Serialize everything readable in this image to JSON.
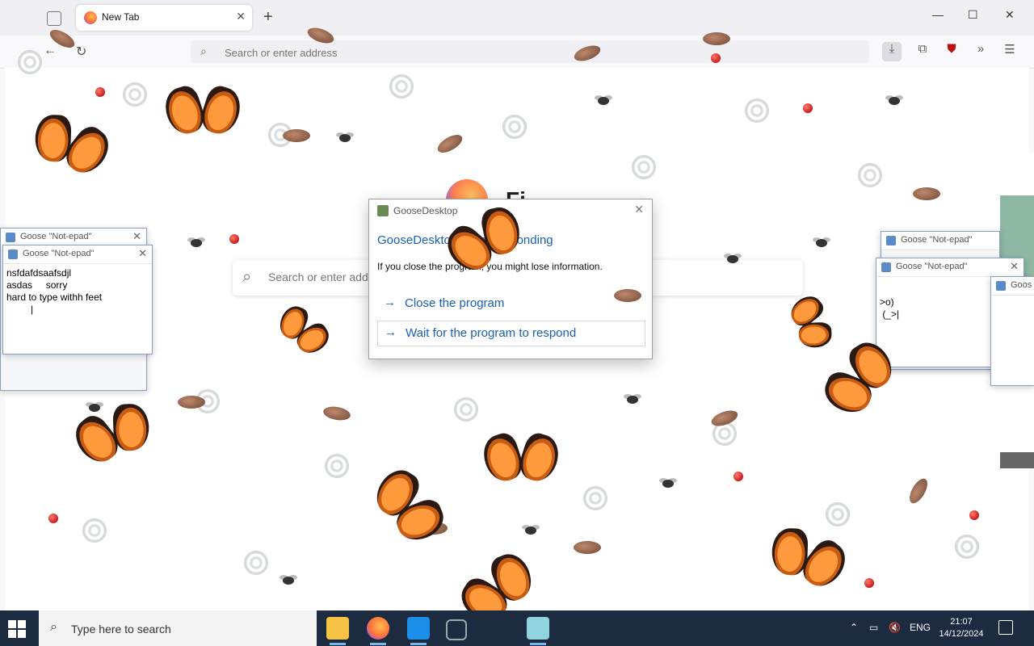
{
  "browser": {
    "tab": {
      "title": "New Tab",
      "close": "✕"
    },
    "new_tab": "+",
    "window_controls": {
      "minimize": "—",
      "maximize": "☐",
      "close": "✕"
    },
    "url_placeholder": "Search or enter address",
    "newtab_search_placeholder": "Search or enter address",
    "logo_word": "Fi",
    "icons": [
      "list-tabs-icon",
      "back-icon",
      "reload-icon",
      "search-icon",
      "download-icon",
      "extensions-icon",
      "ublock-icon",
      "overflow-icon",
      "menu-icon"
    ]
  },
  "dialog": {
    "title": "GooseDesktop",
    "heading": "GooseDesktop is not responding",
    "text": "If you close the program, you might lose information.",
    "option_close": "Close the program",
    "option_wait": "Wait for the program to respond",
    "close": "✕"
  },
  "notepad_left_back": {
    "title": "Goose \"Not-epad\"",
    "close": "✕"
  },
  "notepad_left": {
    "title": "Goose \"Not-epad\"",
    "close": "✕",
    "body": "nsfdafdsaafsdjl\nasdas     sorry\nhard to type withh feet\n         |"
  },
  "notepad_right_back": {
    "title": "Goose \"Not-epad\"",
    "close": "✕"
  },
  "notepad_right": {
    "title": "Goose \"Not-epad\"",
    "close": "✕",
    "body": ">o)\n (_>|"
  },
  "notepad_far_right": {
    "title": "Goos"
  },
  "taskbar": {
    "search_placeholder": "Type here to search",
    "language": "ENG",
    "time": "21:07",
    "date": "14/12/2024",
    "apps": [
      "file-explorer-icon",
      "firefox-icon",
      "app-blue-icon",
      "app-hex-icon",
      "app-cube-icon"
    ]
  }
}
